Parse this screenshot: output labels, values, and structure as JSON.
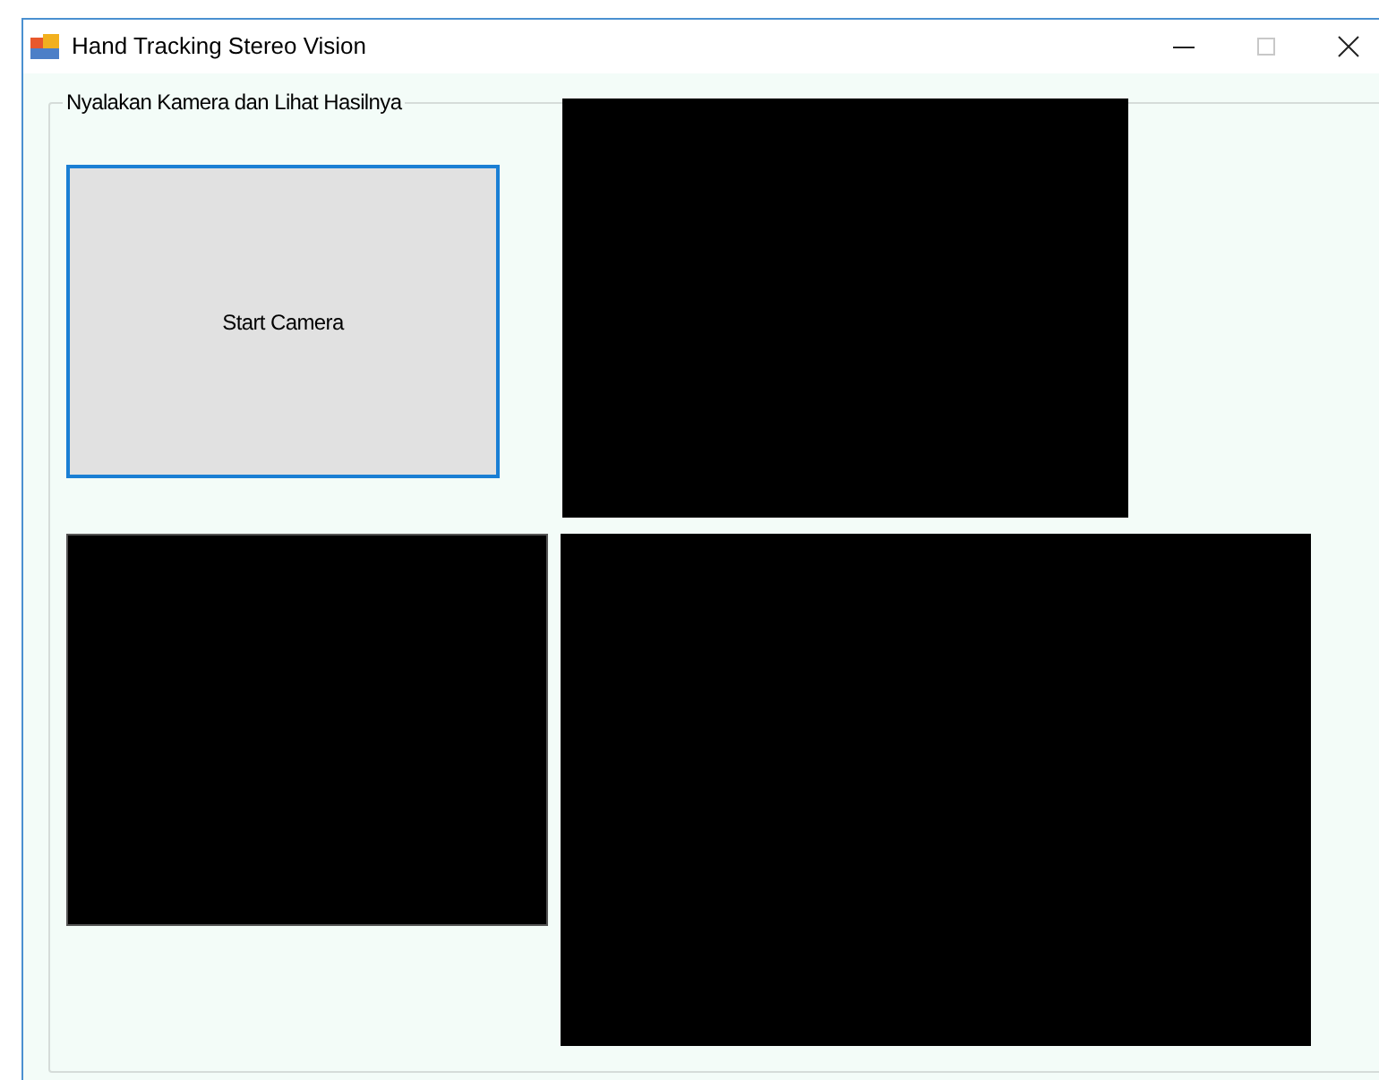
{
  "window": {
    "title": "Hand Tracking Stereo Vision",
    "controls": [
      {
        "kind": "minimize",
        "disabled": false
      },
      {
        "kind": "maximize",
        "disabled": true
      },
      {
        "kind": "close",
        "disabled": false
      }
    ]
  },
  "group": {
    "label": "Nyalakan Kamera dan Lihat Hasilnya"
  },
  "start_button": {
    "label": "Start Camera",
    "focused": true
  }
}
